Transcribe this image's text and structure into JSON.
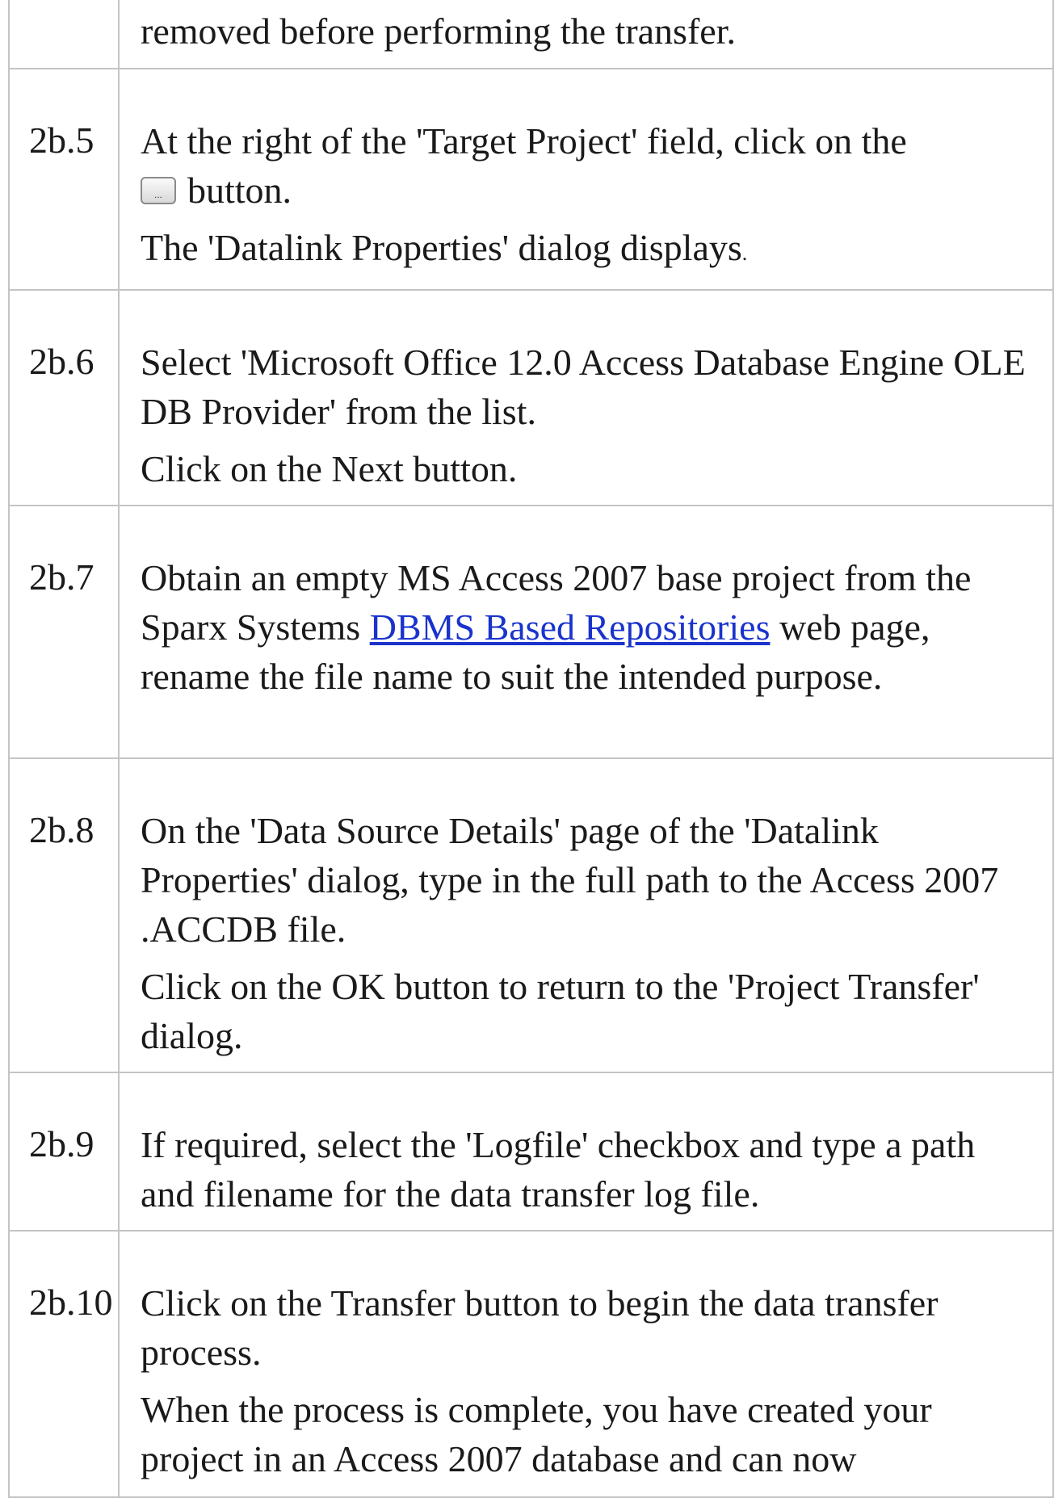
{
  "rows": [
    {
      "step": "",
      "paragraphs": [
        "removed before performing the transfer."
      ]
    },
    {
      "step": "2b.5",
      "p1_before": "At the right of the 'Target Project' field, click on the",
      "p1_after": "button.",
      "p2_main": "The 'Datalink Properties' dialog displays",
      "p2_end": "."
    },
    {
      "step": "2b.6",
      "paragraphs": [
        "Select 'Microsoft Office 12.0 Access Database Engine OLE DB Provider' from the list.",
        "Click on the Next button."
      ]
    },
    {
      "step": "2b.7",
      "before_link": "Obtain an empty MS Access 2007 base project from the Sparx Systems",
      "link": "DBMS Based Repositories",
      "after_link": "web page, rename the file name to suit the intended purpose."
    },
    {
      "step": "2b.8",
      "paragraphs": [
        "On the 'Data Source Details' page of the 'Datalink Properties' dialog, type in the full path to the Access 2007 .ACCDB file.",
        "Click on the OK button to return to the 'Project Transfer' dialog."
      ]
    },
    {
      "step": "2b.9",
      "paragraphs": [
        "If required, select the 'Logfile' checkbox and type a path and filename for the data transfer log file."
      ]
    },
    {
      "step": "2b.10",
      "paragraphs": [
        "Click on the Transfer button to begin the data transfer process.",
        "When the process is complete, you have created your project in an Access 2007 database and can now"
      ]
    }
  ],
  "icons": {
    "browse_button": "ellipsis-button-icon"
  }
}
